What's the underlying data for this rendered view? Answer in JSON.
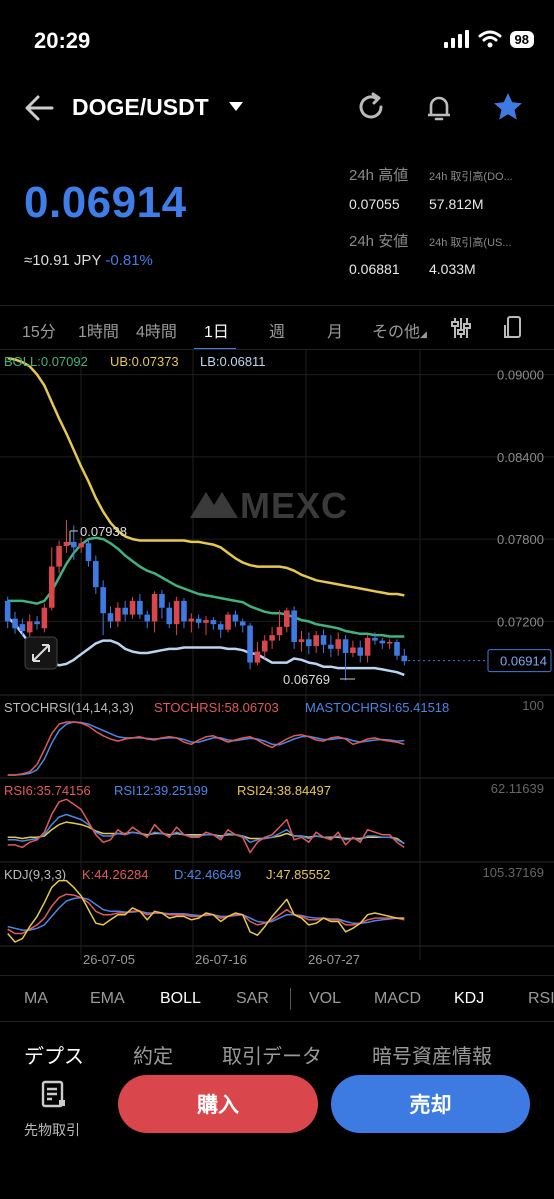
{
  "status": {
    "time": "20:29",
    "battery": "98"
  },
  "header": {
    "pair": "DOGE/USDT"
  },
  "price": {
    "last": "0.06914",
    "jpy": "≈10.91 JPY",
    "change": "-0.81%"
  },
  "stats": {
    "high_label": "24h 高値",
    "high": "0.07055",
    "vol_coin_label": "24h 取引高(DO...",
    "vol_coin": "57.812M",
    "low_label": "24h 安値",
    "low": "0.06881",
    "vol_usdt_label": "24h 取引高(US...",
    "vol_usdt": "4.033M"
  },
  "intervals": [
    "15分",
    "1時間",
    "4時間",
    "1日",
    "週",
    "月",
    "その他"
  ],
  "active_interval": "1日",
  "chart": {
    "watermark": "MEXC",
    "boll_label": "BOLL:0.07092",
    "ub_label": "UB:0.07373",
    "lb_label": "LB:0.06811",
    "price_ticks": [
      "0.09000",
      "0.08400",
      "0.07800",
      "0.07200"
    ],
    "last_price_tag": "0.06914",
    "max_marker": "0.07938",
    "min_marker": "0.06769",
    "stoch_label": "STOCHRSI(14,14,3,3)",
    "stoch_val": "STOCHRSI:58.06703",
    "mastoch_val": "MASTOCHRSI:65.41518",
    "stoch_axis": "100",
    "rsi6": "RSI6:35.74156",
    "rsi12": "RSI12:39.25199",
    "rsi24": "RSI24:38.84497",
    "rsi_axis": "62.11639",
    "kdj_label": "KDJ(9,3,3)",
    "kdj_k": "K:44.26284",
    "kdj_d": "D:42.46649",
    "kdj_j": "J:47.85552",
    "kdj_axis": "105.37169",
    "dates": [
      "26-07-05",
      "26-07-16",
      "26-07-27"
    ]
  },
  "indicators": [
    "MA",
    "EMA",
    "BOLL",
    "SAR",
    "VOL",
    "MACD",
    "KDJ",
    "RSI"
  ],
  "indicators_on": [
    "BOLL",
    "KDJ"
  ],
  "tabs": [
    "デプス",
    "約定",
    "取引データ",
    "暗号資産情報"
  ],
  "futures_label": "先物取引",
  "buy_label": "購入",
  "sell_label": "売却",
  "colors": {
    "up": "#d9474c",
    "down": "#3d7be3",
    "boll": "#3fb27f",
    "ub": "#e6c94a",
    "lb": "#b8d6f2"
  },
  "chart_data": {
    "type": "candlestick",
    "y_range": [
      0.067,
      0.0915
    ],
    "y_ticks": [
      0.09,
      0.084,
      0.078,
      0.072
    ],
    "candles": [
      [
        0.0735,
        0.072,
        0.0738,
        0.0715
      ],
      [
        0.0722,
        0.0715,
        0.0727,
        0.0711
      ],
      [
        0.0718,
        0.0713,
        0.0722,
        0.0709
      ],
      [
        0.0712,
        0.072,
        0.0725,
        0.0707
      ],
      [
        0.072,
        0.0718,
        0.0724,
        0.0714
      ],
      [
        0.0715,
        0.073,
        0.0733,
        0.0712
      ],
      [
        0.073,
        0.076,
        0.0774,
        0.0728
      ],
      [
        0.076,
        0.0775,
        0.0779,
        0.0755
      ],
      [
        0.0775,
        0.0778,
        0.0794,
        0.077
      ],
      [
        0.0778,
        0.0774,
        0.079,
        0.0765
      ],
      [
        0.0774,
        0.0777,
        0.0781,
        0.077
      ],
      [
        0.0777,
        0.0764,
        0.078,
        0.076
      ],
      [
        0.0764,
        0.0745,
        0.0768,
        0.074
      ],
      [
        0.0745,
        0.0726,
        0.075,
        0.071
      ],
      [
        0.0726,
        0.072,
        0.0731,
        0.0715
      ],
      [
        0.072,
        0.073,
        0.0734,
        0.0716
      ],
      [
        0.073,
        0.0725,
        0.0735,
        0.072
      ],
      [
        0.0725,
        0.0735,
        0.0738,
        0.0722
      ],
      [
        0.0735,
        0.0725,
        0.074,
        0.0722
      ],
      [
        0.0725,
        0.072,
        0.0728,
        0.0715
      ],
      [
        0.072,
        0.074,
        0.0742,
        0.0712
      ],
      [
        0.074,
        0.073,
        0.0743,
        0.0722
      ],
      [
        0.073,
        0.0718,
        0.0734,
        0.0715
      ],
      [
        0.0718,
        0.0735,
        0.0738,
        0.071
      ],
      [
        0.0735,
        0.072,
        0.0737,
        0.0715
      ],
      [
        0.072,
        0.0722,
        0.0726,
        0.0712
      ],
      [
        0.0722,
        0.0719,
        0.0725,
        0.0715
      ],
      [
        0.0719,
        0.0721,
        0.0724,
        0.071
      ],
      [
        0.0721,
        0.0718,
        0.0723,
        0.0714
      ],
      [
        0.0718,
        0.0714,
        0.072,
        0.0708
      ],
      [
        0.0714,
        0.0725,
        0.0727,
        0.0712
      ],
      [
        0.0725,
        0.072,
        0.0728,
        0.0716
      ],
      [
        0.072,
        0.0717,
        0.0722,
        0.0712
      ],
      [
        0.0717,
        0.069,
        0.0719,
        0.0685
      ],
      [
        0.069,
        0.0698,
        0.0705,
        0.0688
      ],
      [
        0.0698,
        0.0706,
        0.071,
        0.0693
      ],
      [
        0.0706,
        0.071,
        0.0716,
        0.07
      ],
      [
        0.071,
        0.0716,
        0.0728,
        0.0706
      ],
      [
        0.0716,
        0.0728,
        0.073,
        0.0712
      ],
      [
        0.0728,
        0.0705,
        0.0731,
        0.07
      ],
      [
        0.0705,
        0.0707,
        0.0713,
        0.0698
      ],
      [
        0.0707,
        0.0702,
        0.0712,
        0.0696
      ],
      [
        0.0702,
        0.071,
        0.0713,
        0.0697
      ],
      [
        0.071,
        0.0703,
        0.0714,
        0.0697
      ],
      [
        0.0703,
        0.07,
        0.071,
        0.0694
      ],
      [
        0.07,
        0.0707,
        0.0712,
        0.0695
      ],
      [
        0.0707,
        0.0697,
        0.071,
        0.0677
      ],
      [
        0.0697,
        0.0701,
        0.0706,
        0.0694
      ],
      [
        0.0701,
        0.0695,
        0.0706,
        0.069
      ],
      [
        0.0695,
        0.0708,
        0.071,
        0.069
      ],
      [
        0.0708,
        0.0706,
        0.0712,
        0.0703
      ],
      [
        0.0706,
        0.0704,
        0.0708,
        0.07
      ],
      [
        0.0704,
        0.0705,
        0.0707,
        0.07
      ],
      [
        0.0705,
        0.0695,
        0.0707,
        0.0692
      ],
      [
        0.0695,
        0.0691,
        0.07,
        0.0688
      ]
    ],
    "boll_mid": [
      0.0735,
      0.0735,
      0.0735,
      0.0734,
      0.0733,
      0.0735,
      0.0742,
      0.0752,
      0.0762,
      0.077,
      0.0776,
      0.078,
      0.0781,
      0.078,
      0.0777,
      0.0773,
      0.0768,
      0.0764,
      0.076,
      0.0757,
      0.0755,
      0.0752,
      0.0749,
      0.0746,
      0.0744,
      0.0742,
      0.074,
      0.0739,
      0.0738,
      0.0737,
      0.0736,
      0.0735,
      0.0734,
      0.0731,
      0.0729,
      0.0727,
      0.0726,
      0.0726,
      0.0725,
      0.0723,
      0.0721,
      0.072,
      0.0718,
      0.0717,
      0.0716,
      0.0715,
      0.0713,
      0.0712,
      0.0711,
      0.0711,
      0.071,
      0.071,
      0.0709,
      0.0709,
      0.0709
    ],
    "boll_ub": [
      0.0912,
      0.0911,
      0.0909,
      0.0906,
      0.09,
      0.0892,
      0.088,
      0.0868,
      0.0857,
      0.0845,
      0.0833,
      0.0822,
      0.081,
      0.08,
      0.0792,
      0.0786,
      0.0782,
      0.078,
      0.0779,
      0.0779,
      0.0779,
      0.0779,
      0.0779,
      0.0779,
      0.0779,
      0.0778,
      0.0778,
      0.0777,
      0.0776,
      0.0774,
      0.077,
      0.0766,
      0.0763,
      0.0761,
      0.076,
      0.076,
      0.076,
      0.076,
      0.0759,
      0.0757,
      0.0754,
      0.0752,
      0.075,
      0.0749,
      0.0748,
      0.0747,
      0.0746,
      0.0745,
      0.0744,
      0.0743,
      0.0742,
      0.0741,
      0.074,
      0.074,
      0.0739
    ],
    "boll_lb": [
      0.0723,
      0.0718,
      0.0711,
      0.0704,
      0.0698,
      0.0693,
      0.069,
      0.0688,
      0.0689,
      0.0692,
      0.0696,
      0.07,
      0.0704,
      0.0706,
      0.0706,
      0.0704,
      0.07,
      0.0698,
      0.0697,
      0.0697,
      0.0698,
      0.0699,
      0.07,
      0.07,
      0.0701,
      0.0701,
      0.0701,
      0.0701,
      0.0701,
      0.0701,
      0.07,
      0.07,
      0.0699,
      0.0697,
      0.0696,
      0.0693,
      0.069,
      0.069,
      0.069,
      0.0693,
      0.0692,
      0.069,
      0.0689,
      0.0687,
      0.0687,
      0.0686,
      0.0686,
      0.0686,
      0.0686,
      0.0686,
      0.0686,
      0.0685,
      0.0684,
      0.0683,
      0.0681
    ],
    "stochrsi": [
      0,
      0,
      2,
      6,
      20,
      48,
      78,
      96,
      100,
      100,
      98,
      92,
      82,
      74,
      68,
      64,
      68,
      70,
      72,
      68,
      66,
      70,
      72,
      70,
      62,
      58,
      66,
      72,
      74,
      68,
      62,
      66,
      70,
      72,
      66,
      58,
      52,
      60,
      68,
      74,
      76,
      72,
      66,
      64,
      70,
      72,
      68,
      58,
      62,
      68,
      70,
      66,
      64,
      62,
      58
    ],
    "mastochrsi": [
      0,
      0,
      1,
      3,
      10,
      30,
      60,
      84,
      96,
      100,
      99,
      96,
      90,
      84,
      78,
      72,
      70,
      70,
      70,
      69,
      68,
      69,
      70,
      70,
      67,
      62,
      62,
      66,
      70,
      70,
      66,
      65,
      67,
      69,
      68,
      64,
      58,
      57,
      62,
      68,
      72,
      73,
      70,
      67,
      67,
      69,
      69,
      65,
      62,
      64,
      66,
      67,
      66,
      64,
      65
    ],
    "rsi6": [
      38,
      38,
      36,
      40,
      42,
      48,
      62,
      72,
      74,
      70,
      66,
      56,
      46,
      40,
      42,
      50,
      46,
      52,
      48,
      44,
      54,
      48,
      44,
      52,
      46,
      44,
      44,
      48,
      46,
      42,
      50,
      46,
      44,
      32,
      40,
      44,
      46,
      52,
      58,
      42,
      44,
      40,
      48,
      44,
      42,
      48,
      38,
      44,
      40,
      50,
      48,
      46,
      46,
      40,
      36
    ],
    "rsi12": [
      42,
      42,
      41,
      42,
      43,
      46,
      54,
      60,
      62,
      60,
      58,
      54,
      48,
      45,
      45,
      47,
      46,
      48,
      47,
      45,
      48,
      47,
      45,
      48,
      46,
      45,
      45,
      46,
      46,
      44,
      47,
      46,
      45,
      40,
      42,
      43,
      44,
      47,
      50,
      45,
      45,
      43,
      45,
      44,
      43,
      45,
      42,
      43,
      42,
      45,
      45,
      44,
      44,
      42,
      39
    ],
    "rsi24": [
      44,
      44,
      43,
      44,
      44,
      45,
      50,
      54,
      56,
      55,
      54,
      52,
      49,
      47,
      47,
      47,
      47,
      48,
      47,
      46,
      47,
      47,
      46,
      47,
      46,
      46,
      46,
      46,
      46,
      45,
      46,
      46,
      45,
      43,
      43,
      43,
      44,
      45,
      47,
      45,
      45,
      44,
      45,
      44,
      44,
      44,
      43,
      43,
      43,
      44,
      44,
      44,
      44,
      43,
      39
    ],
    "kdj_k": [
      55,
      50,
      50,
      55,
      60,
      68,
      82,
      92,
      96,
      95,
      92,
      86,
      76,
      72,
      72,
      74,
      74,
      76,
      76,
      72,
      74,
      74,
      72,
      72,
      72,
      70,
      70,
      72,
      72,
      68,
      70,
      72,
      72,
      64,
      60,
      62,
      66,
      72,
      78,
      72,
      70,
      66,
      66,
      68,
      66,
      66,
      60,
      60,
      62,
      66,
      68,
      68,
      68,
      68,
      66
    ],
    "kdj_d": [
      58,
      56,
      54,
      54,
      56,
      60,
      70,
      80,
      88,
      91,
      92,
      90,
      84,
      78,
      76,
      76,
      75,
      75,
      76,
      74,
      74,
      74,
      73,
      73,
      73,
      72,
      71,
      71,
      72,
      70,
      70,
      71,
      72,
      68,
      64,
      63,
      64,
      68,
      72,
      72,
      71,
      69,
      68,
      68,
      67,
      67,
      64,
      62,
      62,
      63,
      65,
      66,
      67,
      68,
      66
    ],
    "kdj_j": [
      50,
      40,
      44,
      58,
      70,
      86,
      104,
      112,
      112,
      104,
      94,
      78,
      62,
      60,
      66,
      72,
      72,
      80,
      76,
      66,
      76,
      74,
      68,
      70,
      70,
      66,
      68,
      74,
      72,
      64,
      70,
      74,
      72,
      52,
      48,
      58,
      70,
      80,
      90,
      72,
      68,
      60,
      62,
      68,
      64,
      64,
      52,
      56,
      62,
      72,
      74,
      72,
      70,
      68,
      68
    ]
  }
}
